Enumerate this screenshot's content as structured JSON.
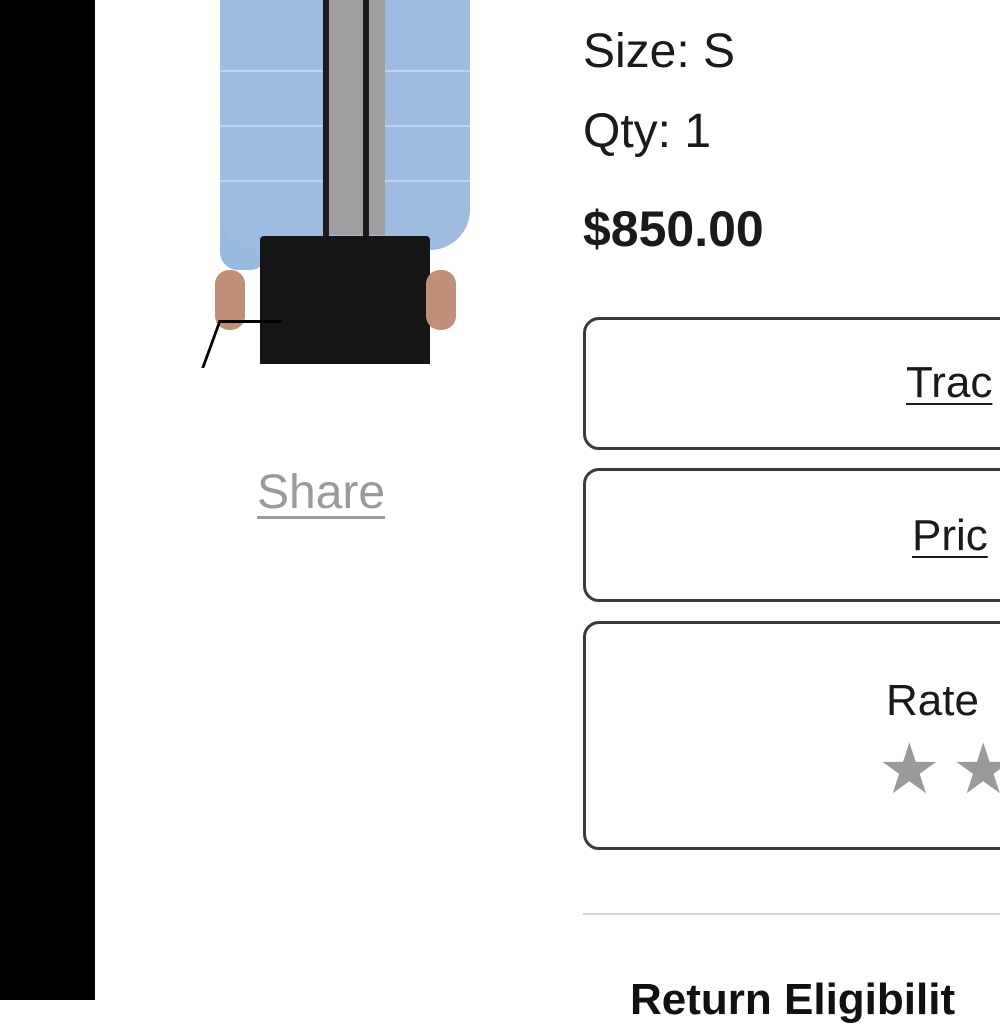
{
  "order_item": {
    "title_partial": "...",
    "size_text": "Size: S",
    "qty_text": "Qty: 1",
    "price": "$850.00"
  },
  "share": {
    "label": "Share"
  },
  "actions": {
    "track_label": "Trac",
    "price_label": "Pric",
    "rate_label": "Rate",
    "rate_stars": 2
  },
  "return_section": {
    "heading": "Return Eligibilit"
  },
  "colors": {
    "jacket": "#9dbce0",
    "share_link": "#9a9a9a",
    "star_inactive": "#9a9a9a"
  }
}
